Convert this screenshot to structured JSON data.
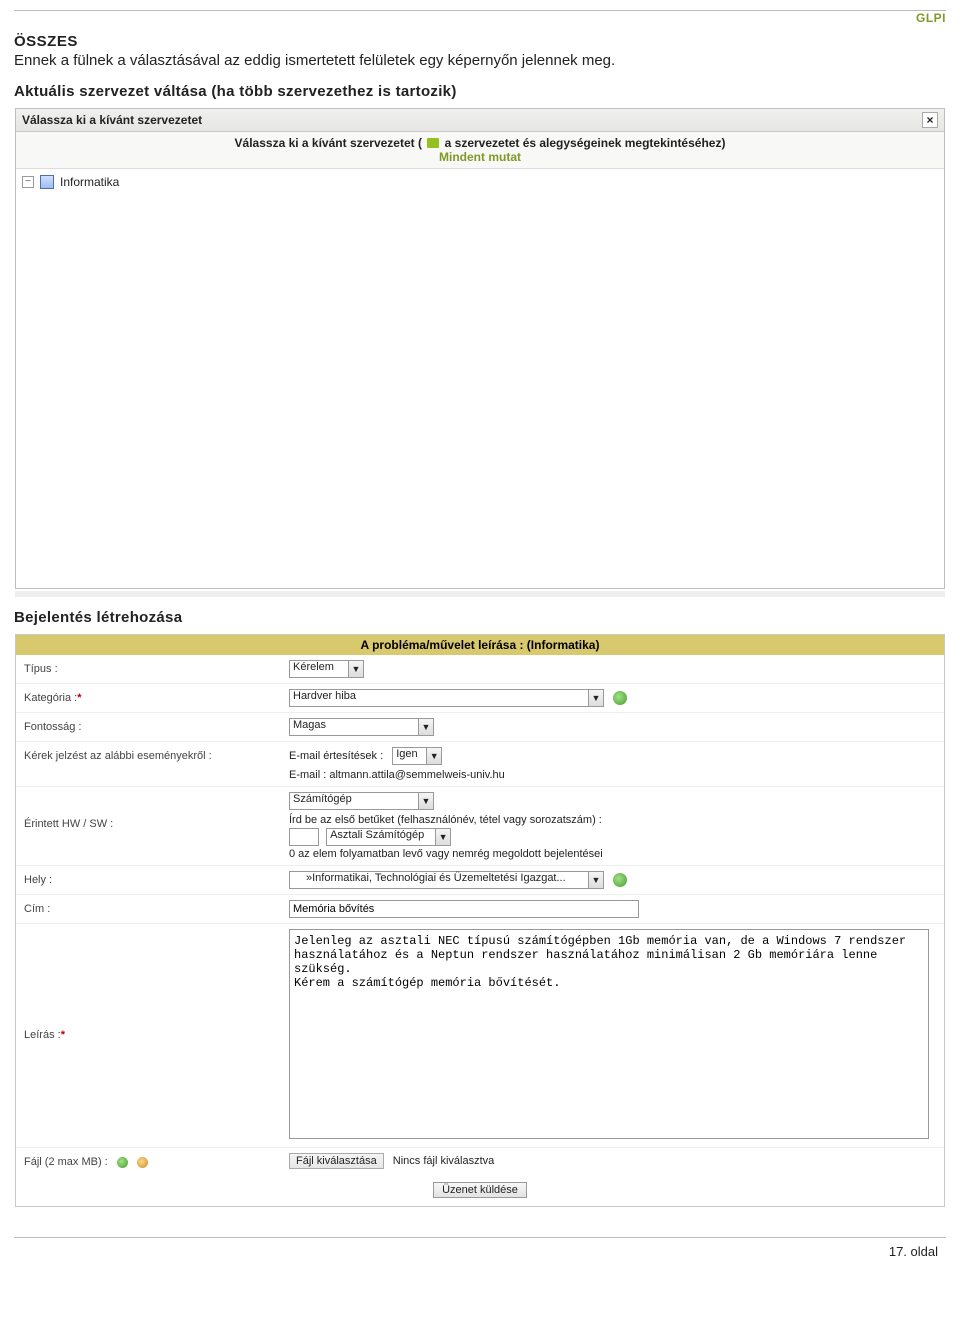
{
  "header": {
    "logo": "GLPI"
  },
  "section_all": {
    "title": "ÖSSZES",
    "desc": "Ennek a fülnek a választásával az eddig ismertetett felületek egy képernyőn jelennek meg."
  },
  "section_org": {
    "title": "Aktuális szervezet váltása (ha több szervezethez is tartozik)",
    "dialog_title": "Válassza ki a kívánt szervezetet",
    "sub_prefix": "Válassza ki a kívánt szervezetet ( ",
    "sub_suffix": " a szervezetet és alegységeinek megtekintéséhez)",
    "show_all": "Mindent mutat",
    "tree_item": "Informatika",
    "close_char": "×"
  },
  "section_report": {
    "title": "Bejelentés létrehozása",
    "form_header": "A probléma/művelet leírása :  (Informatika)",
    "labels": {
      "type": "Típus :",
      "category": "Kategória :",
      "importance": "Fontosság :",
      "notify": "Kérek jelzést az alábbi eseményekről :",
      "hw": "Érintett HW / SW :",
      "place": "Hely :",
      "title_f": "Cím :",
      "desc": "Leírás :",
      "file": "Fájl (2 max MB) : "
    },
    "values": {
      "type": "Kérelem",
      "category": "Hardver hiba",
      "importance": "Magas",
      "email_notif_lbl": "E-mail értesítések :",
      "email_notif_val": "Igen",
      "email_line_lbl": "E-mail : ",
      "email_line_val": "altmann.attila@semmelweis-univ.hu",
      "hw_sel": "Számítógép",
      "hw_instr": "Írd be az első betűket (felhasználónév, tétel vagy sorozatszám) :",
      "hw_input": "",
      "hw_sub_sel": "Asztali Számítógép",
      "hw_status": "0 az elem folyamatban levő vagy nemrég megoldott bejelentései",
      "place": "»Informatikai, Technológiai és Üzemeltetési Igazgat...",
      "title_f": "Memória bővítés",
      "desc": "Jelenleg az asztali NEC típusú számítógépben 1Gb memória van, de a Windows 7 rendszer használatához és a Neptun rendszer használatához minimálisan 2 Gb memóriára lenne szükség.\nKérem a számítógép memória bővítését.",
      "file_btn": "Fájl kiválasztása",
      "file_status": "Nincs fájl kiválasztva",
      "submit": "Üzenet küldése"
    },
    "mand": "*"
  },
  "footer": {
    "page_num": "17. oldal"
  }
}
